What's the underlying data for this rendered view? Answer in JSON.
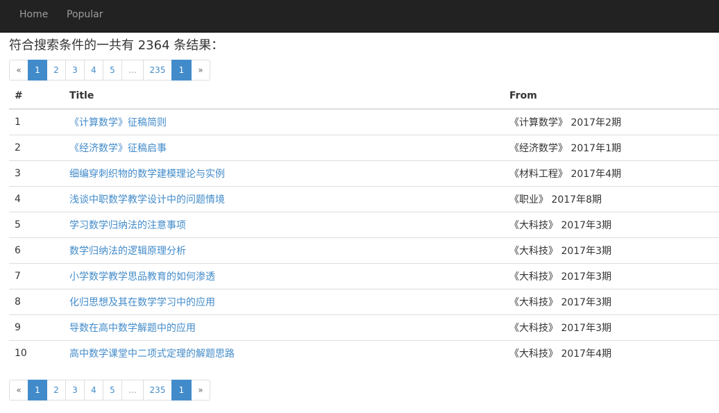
{
  "nav": {
    "home": "Home",
    "popular": "Popular"
  },
  "summary": "符合搜索条件的一共有 2364 条结果：",
  "pagination": {
    "prev": "«",
    "pages": [
      "1",
      "2",
      "3",
      "4",
      "5"
    ],
    "ellipsis": "...",
    "last": "235",
    "current": "1",
    "next": "»"
  },
  "table": {
    "headers": {
      "num": "#",
      "title": "Title",
      "from": "From"
    },
    "rows": [
      {
        "num": "1",
        "title": "《计算数学》征稿简则",
        "from": "《计算数学》 2017年2期"
      },
      {
        "num": "2",
        "title": "《经济数学》征稿启事",
        "from": "《经济数学》 2017年1期"
      },
      {
        "num": "3",
        "title": "细编穿刺织物的数学建模理论与实例",
        "from": "《材料工程》 2017年4期"
      },
      {
        "num": "4",
        "title": "浅谈中职数学教学设计中的问题情境",
        "from": "《职业》 2017年8期"
      },
      {
        "num": "5",
        "title": "学习数学归纳法的注意事项",
        "from": "《大科技》 2017年3期"
      },
      {
        "num": "6",
        "title": "数学归纳法的逻辑原理分析",
        "from": "《大科技》 2017年3期"
      },
      {
        "num": "7",
        "title": "小学数学教学思品教育的如何渗透",
        "from": "《大科技》 2017年3期"
      },
      {
        "num": "8",
        "title": "化归思想及其在数学学习中的应用",
        "from": "《大科技》 2017年3期"
      },
      {
        "num": "9",
        "title": "导数在高中数学解题中的应用",
        "from": "《大科技》 2017年3期"
      },
      {
        "num": "10",
        "title": "高中数学课堂中二项式定理的解题思路",
        "from": "《大科技》 2017年4期"
      }
    ]
  },
  "colors": {
    "navbar_bg": "#222222",
    "link": "#428bca",
    "active_page": "#428bca"
  }
}
